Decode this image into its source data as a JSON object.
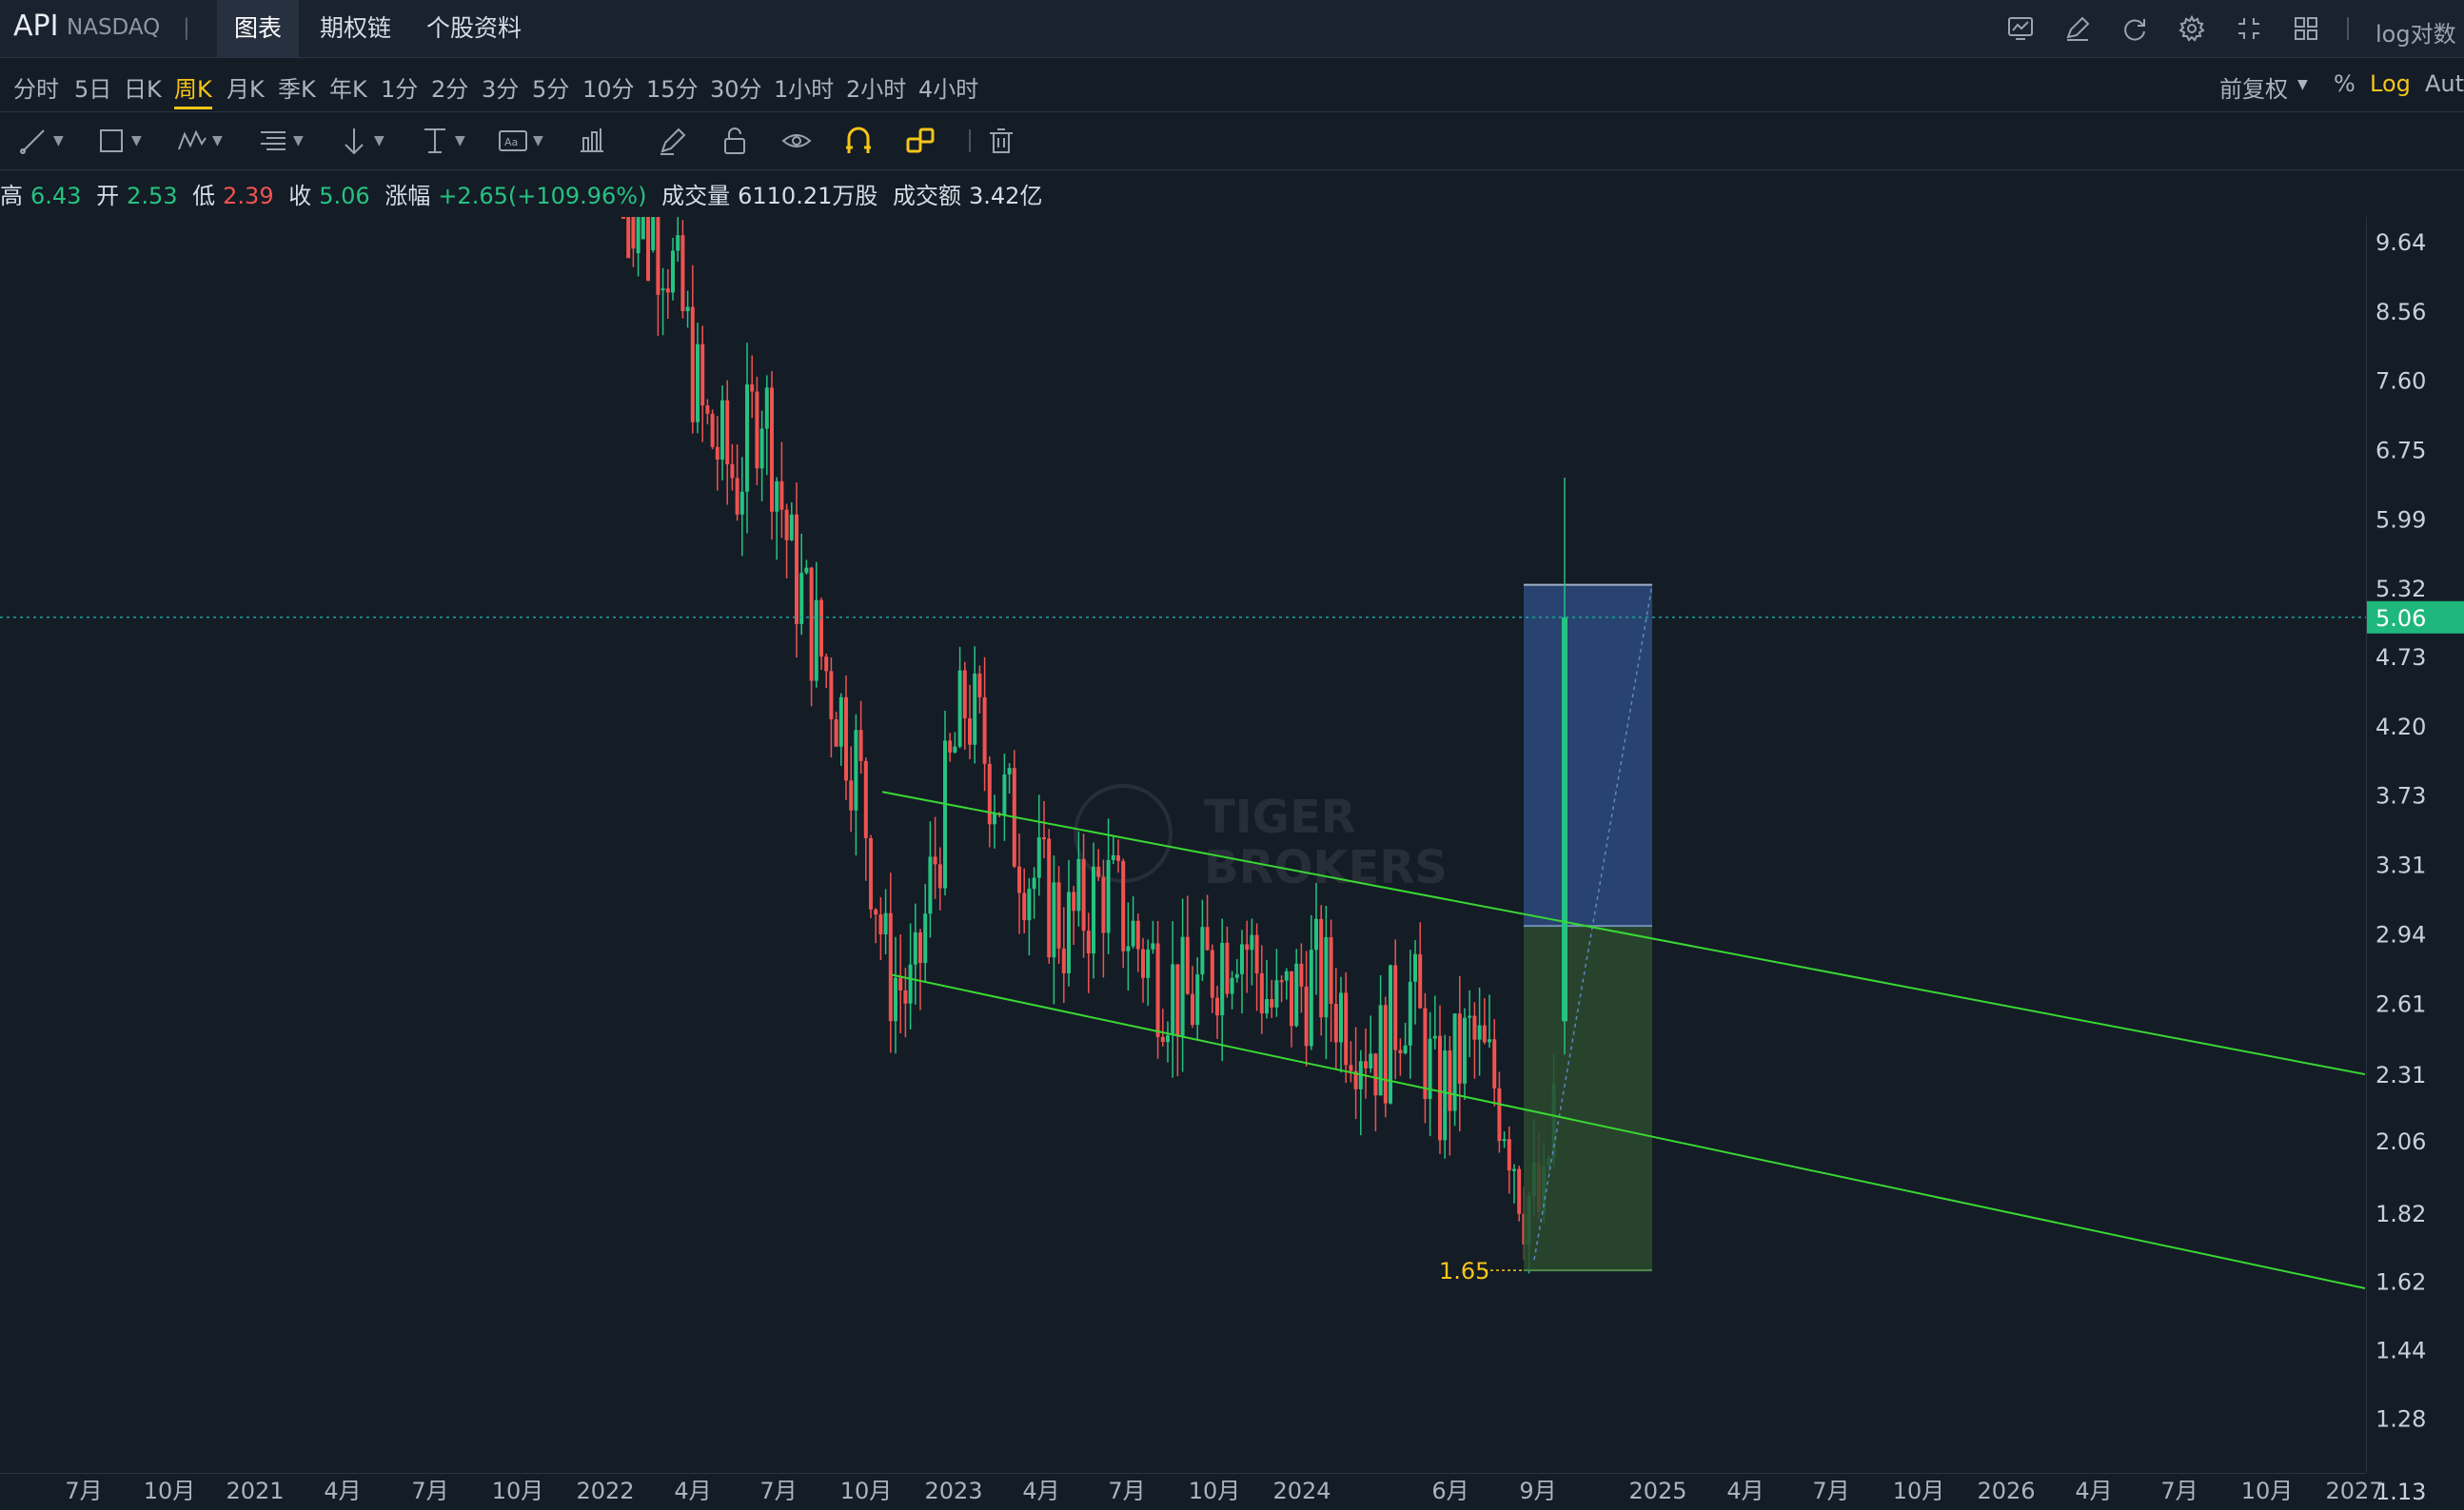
{
  "header": {
    "ticker": "API",
    "exchange": "NASDAQ",
    "separator": "|",
    "tabs": [
      {
        "label": "图表",
        "active": true
      },
      {
        "label": "期权链",
        "active": false
      },
      {
        "label": "个股资料",
        "active": false
      }
    ],
    "icons": [
      "chart-template-icon",
      "draw-edit-icon",
      "refresh-icon",
      "settings-icon",
      "fullscreen-icon",
      "layout-grid-icon"
    ],
    "log_label": "log对数"
  },
  "periods": {
    "items": [
      "分时",
      "5日",
      "日K",
      "周K",
      "月K",
      "季K",
      "年K",
      "1分",
      "2分",
      "3分",
      "5分",
      "10分",
      "15分",
      "30分",
      "1小时",
      "2小时",
      "4小时"
    ],
    "active": "周K",
    "adjust": "前复权",
    "percent": "%",
    "log": "Log",
    "auto": "Auto"
  },
  "drawing_tools": [
    "line-tool-icon",
    "rectangle-tool-icon",
    "pattern-tool-icon",
    "fib-tool-icon",
    "arrow-tool-icon",
    "measure-tool-icon",
    "text-tool-icon",
    "bar-pattern-icon",
    "pencil-icon",
    "lock-icon",
    "eye-icon",
    "magnet-icon",
    "link-icon",
    "trash-icon"
  ],
  "quote": {
    "high_label": "高",
    "high": "6.43",
    "open_label": "开",
    "open": "2.53",
    "low_label": "低",
    "low": "2.39",
    "close_label": "收",
    "close": "5.06",
    "change_label": "涨幅",
    "change": "+2.65(+109.96%)",
    "volume_label": "成交量",
    "volume": "6110.21万股",
    "turnover_label": "成交额",
    "turnover": "3.42亿"
  },
  "colors": {
    "up": "#26c281",
    "down": "#ef5350",
    "channel": "#39d833",
    "accent": "#f5c518",
    "background": "#141c26"
  },
  "chart_data": {
    "type": "candlestick",
    "interval": "weekly",
    "scale": "log",
    "y_ticks": [
      "9.64",
      "8.56",
      "7.60",
      "6.75",
      "5.99",
      "5.32",
      "4.73",
      "4.20",
      "3.73",
      "3.31",
      "2.94",
      "2.61",
      "2.31",
      "2.06",
      "1.82",
      "1.62",
      "1.44",
      "1.28",
      "1.13"
    ],
    "x_ticks": [
      "7月",
      "10月",
      "2021",
      "4月",
      "7月",
      "10月",
      "2022",
      "4月",
      "7月",
      "10月",
      "2023",
      "4月",
      "7月",
      "10月",
      "2024",
      "6月",
      "9月",
      "2025",
      "4月",
      "7月",
      "10月",
      "2026",
      "4月",
      "7月",
      "10月",
      "2027"
    ],
    "last_price": "5.06",
    "marked_low": "1.65",
    "watermark": [
      "TIGER",
      "BROKERS"
    ],
    "channel": {
      "upper": [
        {
          "x": "2022-10",
          "y": 3.75
        },
        {
          "x": "2027-01",
          "y": 2.31
        }
      ],
      "lower": [
        {
          "x": "2022-10",
          "y": 2.74
        },
        {
          "x": "2027-01",
          "y": 1.6
        }
      ]
    },
    "position_tool": {
      "entry": 2.98,
      "target": 5.35,
      "stop": 1.65,
      "profit_color": "#2c4a7c",
      "loss_color": "#2a4a2e"
    }
  }
}
